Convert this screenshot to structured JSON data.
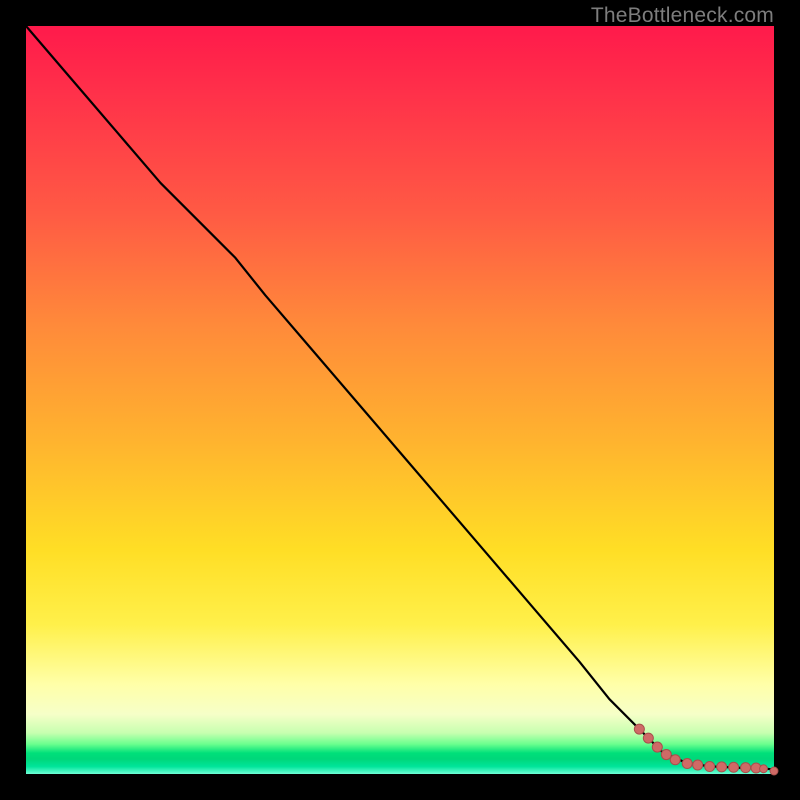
{
  "watermark": "TheBottleneck.com",
  "colors": {
    "dot_fill": "#cf6a66",
    "dot_stroke": "#a84f4c",
    "curve": "#000000"
  },
  "chart_data": {
    "type": "line",
    "title": "",
    "xlabel": "",
    "ylabel": "",
    "xlim": [
      0,
      100
    ],
    "ylim": [
      0,
      100
    ],
    "series": [
      {
        "name": "bottleneck-curve",
        "x": [
          0,
          6,
          12,
          18,
          24,
          28,
          32,
          38,
          44,
          50,
          56,
          62,
          68,
          74,
          78,
          82,
          85,
          88,
          90,
          92,
          94,
          96,
          98,
          100
        ],
        "y": [
          100,
          93,
          86,
          79,
          73,
          69,
          64,
          57,
          50,
          43,
          36,
          29,
          22,
          15,
          10,
          6,
          3,
          1.6,
          1.2,
          1.0,
          0.9,
          0.8,
          0.8,
          0.6
        ]
      }
    ],
    "scatter": [
      {
        "name": "data-points",
        "points": [
          {
            "x": 82.0,
            "y": 6.0,
            "r": 5
          },
          {
            "x": 83.2,
            "y": 4.8,
            "r": 5
          },
          {
            "x": 84.4,
            "y": 3.6,
            "r": 5
          },
          {
            "x": 85.6,
            "y": 2.6,
            "r": 5
          },
          {
            "x": 86.8,
            "y": 1.9,
            "r": 5
          },
          {
            "x": 88.4,
            "y": 1.4,
            "r": 5
          },
          {
            "x": 89.8,
            "y": 1.2,
            "r": 5
          },
          {
            "x": 91.4,
            "y": 1.0,
            "r": 5
          },
          {
            "x": 93.0,
            "y": 0.95,
            "r": 5
          },
          {
            "x": 94.6,
            "y": 0.9,
            "r": 5
          },
          {
            "x": 96.2,
            "y": 0.85,
            "r": 5
          },
          {
            "x": 97.6,
            "y": 0.8,
            "r": 5
          },
          {
            "x": 98.6,
            "y": 0.7,
            "r": 4
          },
          {
            "x": 100.0,
            "y": 0.4,
            "r": 4
          }
        ]
      }
    ]
  }
}
